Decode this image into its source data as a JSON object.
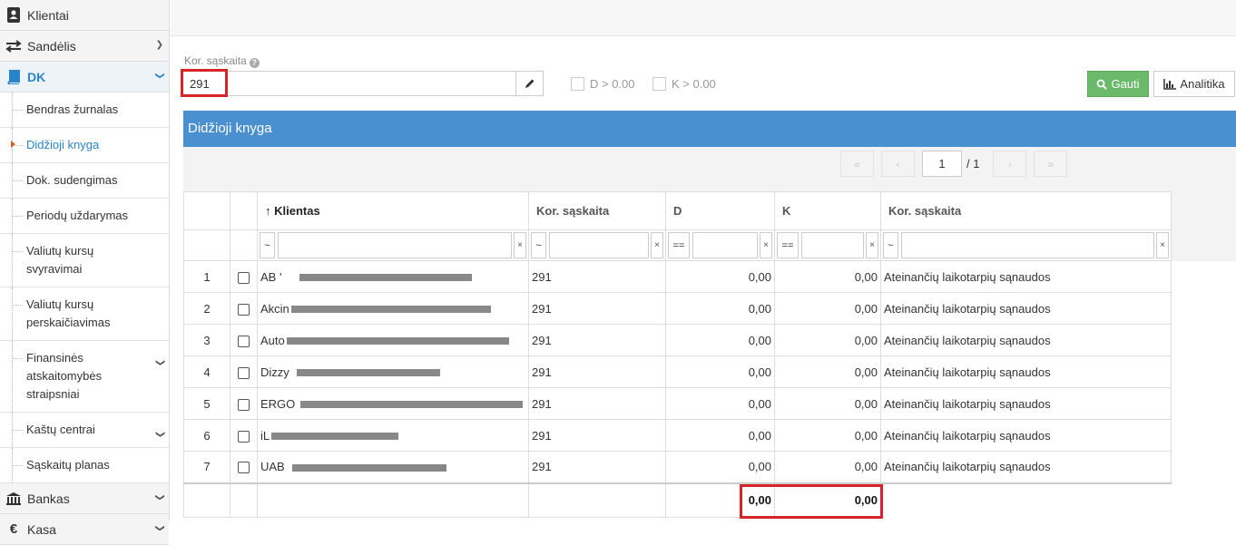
{
  "sidebar": {
    "top_items": [
      {
        "label": "Klientai",
        "icon": "contact-book-icon"
      },
      {
        "label": "Sandėlis",
        "icon": "exchange-arrows-icon"
      },
      {
        "label": "DK",
        "icon": "book-icon"
      }
    ],
    "dk_subitems": [
      {
        "label": "Bendras žurnalas"
      },
      {
        "label": "Didžioji knyga"
      },
      {
        "label": "Dok. sudengimas"
      },
      {
        "label": "Periodų uždarymas"
      },
      {
        "label": "Valiutų kursų svyravimai"
      },
      {
        "label": "Valiutų kursų perskaičiavimas"
      },
      {
        "label": "Finansinės atskaitomybės straipsniai"
      },
      {
        "label": "Kaštų centrai"
      },
      {
        "label": "Sąskaitų planas"
      }
    ],
    "bottom_items": [
      {
        "label": "Bankas",
        "icon": "bank-icon"
      },
      {
        "label": "Kasa",
        "icon": "euro-icon"
      }
    ]
  },
  "filter": {
    "label": "Kor. sąskaita",
    "value": "291",
    "chk_d_label": "D > 0.00",
    "chk_k_label": "K > 0.00",
    "gauti_label": "Gauti",
    "analitika_label": "Analitika"
  },
  "panel": {
    "title": "Didžioji knyga"
  },
  "pager": {
    "current": "1",
    "total": "/ 1"
  },
  "table": {
    "headers": {
      "klientas": "Klientas",
      "kor1": "Kor. sąskaita",
      "d": "D",
      "k": "K",
      "kor2": "Kor. sąskaita"
    },
    "filter_ops": {
      "tilde": "~",
      "eq": "==",
      "clear": "×"
    },
    "rows": [
      {
        "n": "1",
        "client": "AB '",
        "kor": "291",
        "d": "0,00",
        "k": "0,00",
        "desc": "Ateinančių laikotarpių sąnaudos"
      },
      {
        "n": "2",
        "client": "Akcin",
        "kor": "291",
        "d": "0,00",
        "k": "0,00",
        "desc": "Ateinančių laikotarpių sąnaudos"
      },
      {
        "n": "3",
        "client": "Auto",
        "kor": "291",
        "d": "0,00",
        "k": "0,00",
        "desc": "Ateinančių laikotarpių sąnaudos"
      },
      {
        "n": "4",
        "client": "Dizzy",
        "kor": "291",
        "d": "0,00",
        "k": "0,00",
        "desc": "Ateinančių laikotarpių sąnaudos"
      },
      {
        "n": "5",
        "client": "ERGO",
        "kor": "291",
        "d": "0,00",
        "k": "0,00",
        "desc": "Ateinančių laikotarpių sąnaudos"
      },
      {
        "n": "6",
        "client": "iL",
        "kor": "291",
        "d": "0,00",
        "k": "0,00",
        "desc": "Ateinančių laikotarpių sąnaudos"
      },
      {
        "n": "7",
        "client": "UAB",
        "kor": "291",
        "d": "0,00",
        "k": "0,00",
        "desc": "Ateinančių laikotarpių sąnaudos"
      }
    ],
    "totals": {
      "d": "0,00",
      "k": "0,00"
    }
  },
  "colors": {
    "accent": "#2a84c8",
    "panel_header": "#4a8fcf",
    "success": "#6bb96b",
    "highlight": "#d9222a"
  }
}
